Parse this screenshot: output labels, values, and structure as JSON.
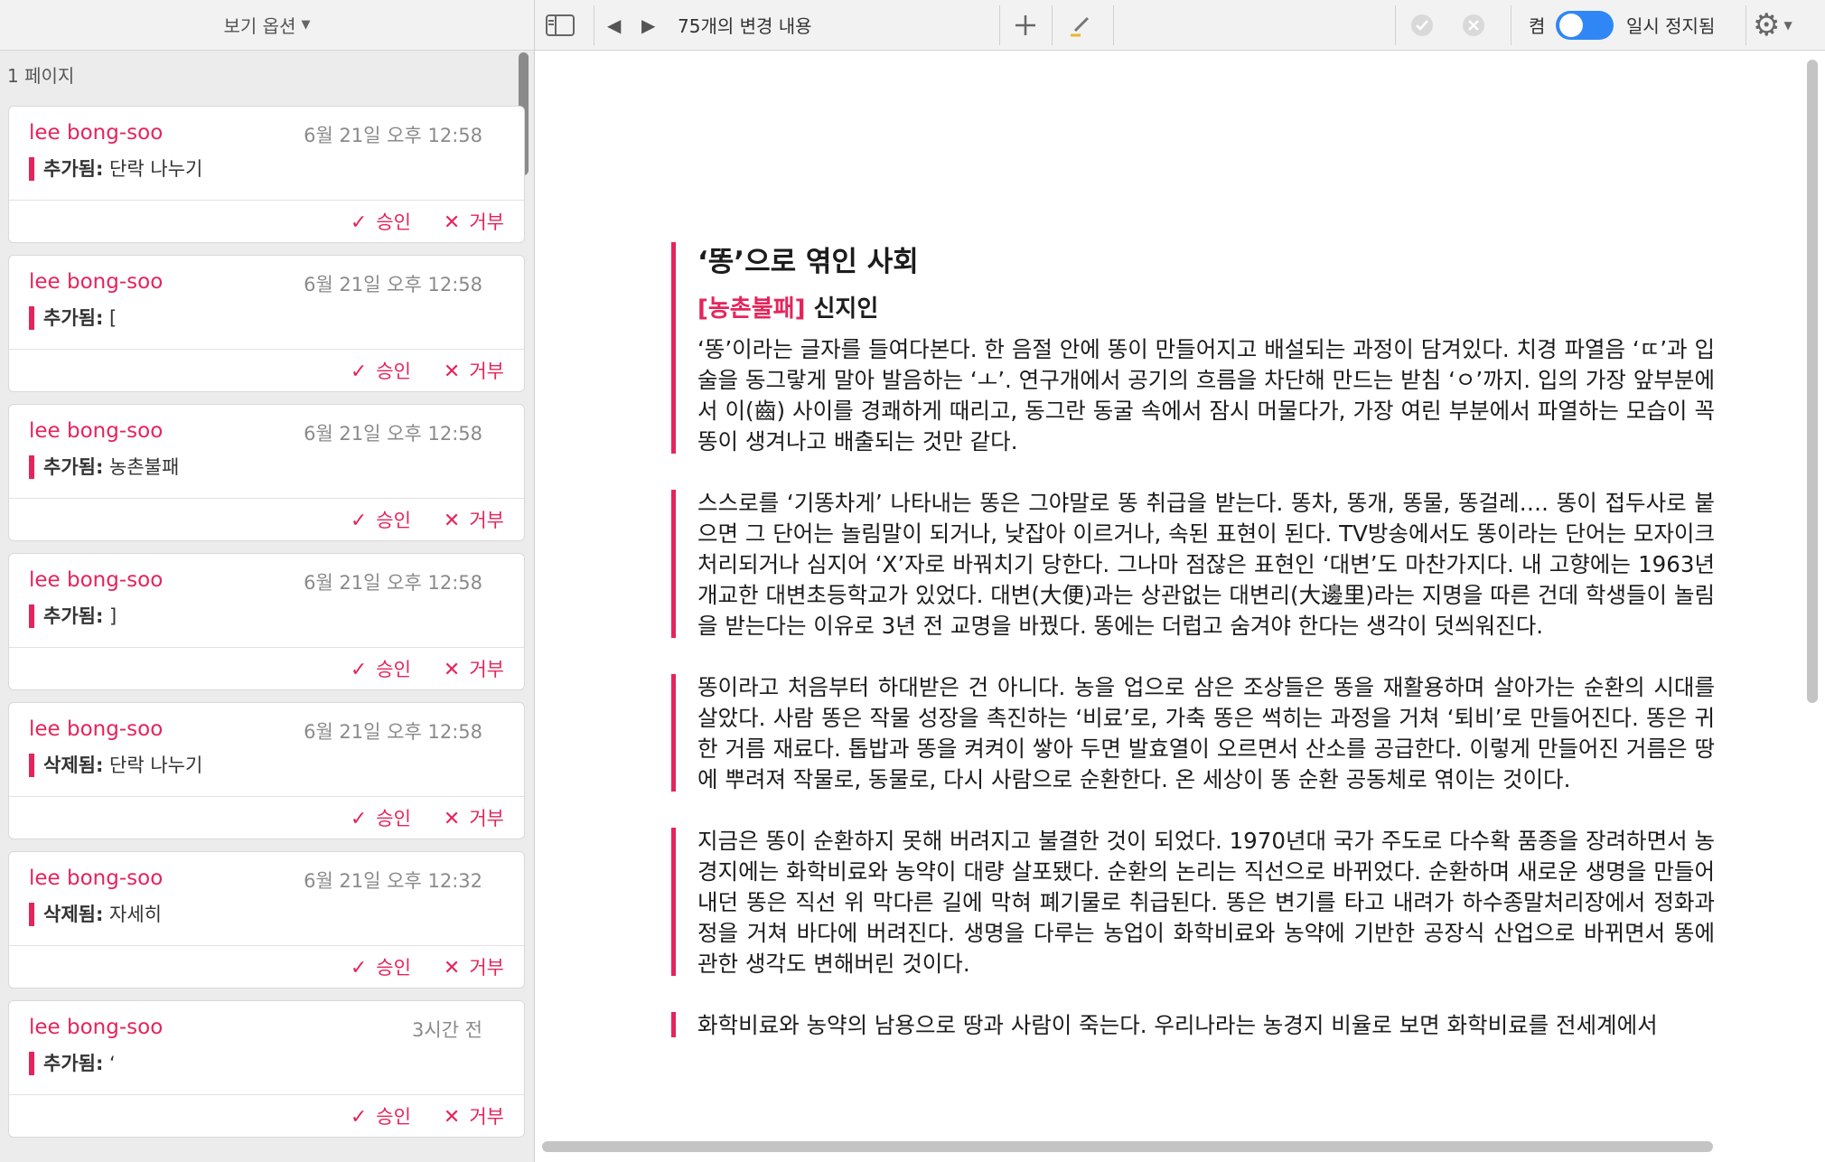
{
  "sidebar": {
    "view_options": "보기 옵션",
    "pages_label": "1 페이지",
    "cards": [
      {
        "author": "lee bong-soo",
        "time": "6월 21일 오후 12:58",
        "kind": "추가됨:",
        "text": "단락 나누기"
      },
      {
        "author": "lee bong-soo",
        "time": "6월 21일 오후 12:58",
        "kind": "추가됨:",
        "text": "["
      },
      {
        "author": "lee bong-soo",
        "time": "6월 21일 오후 12:58",
        "kind": "추가됨:",
        "text": "농촌불패"
      },
      {
        "author": "lee bong-soo",
        "time": "6월 21일 오후 12:58",
        "kind": "추가됨:",
        "text": "]"
      },
      {
        "author": "lee bong-soo",
        "time": "6월 21일 오후 12:58",
        "kind": "삭제됨:",
        "text": "단락 나누기"
      },
      {
        "author": "lee bong-soo",
        "time": "6월 21일 오후 12:32",
        "kind": "삭제됨:",
        "text": "자세히"
      },
      {
        "author": "lee bong-soo",
        "time": "3시간 전",
        "kind": "추가됨:",
        "text": "‘"
      }
    ],
    "accept_label": "승인",
    "reject_label": "거부"
  },
  "toolbar": {
    "changes_count": "75개의 변경 내용",
    "on_label": "켬",
    "paused_label": "일시 정지됨"
  },
  "document": {
    "title": "‘똥’으로 엮인 사회",
    "subtitle_tag": "[농촌불패]",
    "subtitle_author": "신지인",
    "paragraphs": [
      "‘똥’이라는 글자를 들여다본다. 한 음절 안에 똥이 만들어지고 배설되는 과정이 담겨있다. 치경 파열음 ‘ㄸ’과 입술을 동그랗게 말아 발음하는 ‘ㅗ’. 연구개에서 공기의 흐름을 차단해 만드는 받침 ‘ㅇ’까지. 입의 가장 앞부분에서 이(齒) 사이를 경쾌하게 때리고, 동그란 동굴 속에서 잠시 머물다가, 가장 여린 부분에서 파열하는 모습이 꼭 똥이 생겨나고 배출되는 것만 같다.",
      "스스로를 ‘기똥차게’ 나타내는 똥은 그야말로 똥 취급을 받는다. 똥차, 똥개, 똥물, 똥걸레…. 똥이 접두사로 붙으면 그 단어는 놀림말이 되거나, 낮잡아 이르거나, 속된 표현이 된다. TV방송에서도 똥이라는 단어는 모자이크 처리되거나 심지어 ‘X’자로 바꿔치기 당한다. 그나마 점잖은 표현인 ‘대변’도 마찬가지다. 내 고향에는 1963년 개교한 대변초등학교가 있었다. 대변(大便)과는 상관없는 대변리(大邊里)라는 지명을 따른 건데 학생들이 놀림을 받는다는 이유로 3년 전 교명을 바꿨다. 똥에는 더럽고 숨겨야 한다는 생각이 덧씌워진다.",
      "똥이라고 처음부터 하대받은 건 아니다. 농을 업으로 삼은 조상들은 똥을 재활용하며 살아가는 순환의 시대를 살았다. 사람 똥은 작물 성장을 촉진하는 ‘비료’로, 가축 똥은 썩히는 과정을 거쳐 ‘퇴비’로 만들어진다. 똥은 귀한 거름 재료다. 톱밥과 똥을 켜켜이 쌓아 두면 발효열이 오르면서 산소를 공급한다. 이렇게 만들어진 거름은 땅에 뿌려져 작물로, 동물로, 다시 사람으로 순환한다. 온 세상이 똥 순환 공동체로 엮이는 것이다.",
      "지금은 똥이 순환하지 못해 버려지고 불결한 것이 되었다. 1970년대 국가 주도로 다수확 품종을 장려하면서 농경지에는 화학비료와 농약이 대량 살포됐다. 순환의 논리는 직선으로 바뀌었다. 순환하며 새로운 생명을 만들어내던 똥은 직선 위 막다른 길에 막혀 폐기물로 취급된다. 똥은 변기를 타고 내려가 하수종말처리장에서 정화과정을 거쳐 바다에 버려진다. 생명을 다루는 농업이 화학비료와 농약에 기반한 공장식 산업으로 바뀌면서 똥에 관한 생각도 변해버린 것이다.",
      "화학비료와 농약의 남용으로 땅과 사람이 죽는다. 우리나라는 농경지 비율로 보면 화학비료를 전세계에서"
    ]
  },
  "colors": {
    "accent": "#e5245b",
    "toggle_on": "#2f87f5"
  }
}
